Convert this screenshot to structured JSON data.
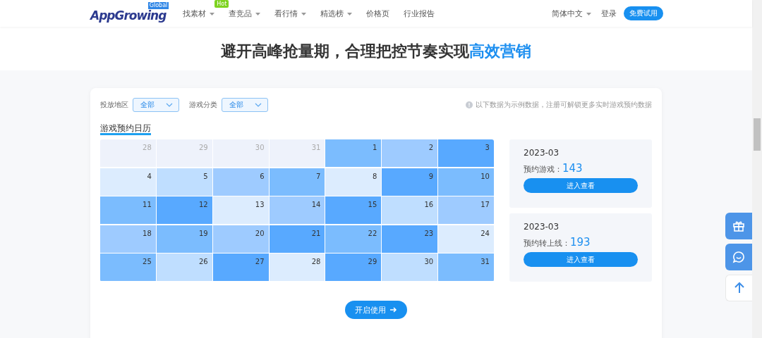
{
  "header": {
    "logo": "AppGrowing",
    "logo_badge": "Global",
    "nav": [
      {
        "label": "找素材",
        "dropdown": true,
        "badge": "Hot"
      },
      {
        "label": "查竞品",
        "dropdown": true
      },
      {
        "label": "看行情",
        "dropdown": true
      },
      {
        "label": "精选榜",
        "dropdown": true
      },
      {
        "label": "价格页",
        "dropdown": false
      },
      {
        "label": "行业报告",
        "dropdown": false
      }
    ],
    "language": "简体中文",
    "login": "登录",
    "trial_button": "免费试用"
  },
  "headline": [
    {
      "text": "避开高峰抢量期，合理把控节奏实现",
      "accent": false
    },
    {
      "text": "高效营销",
      "accent": true
    }
  ],
  "filters": [
    {
      "label": "投放地区",
      "value": "全部"
    },
    {
      "label": "游戏分类",
      "value": "全部"
    }
  ],
  "notice": "以下数据为示例数据，注册可解锁更多实时游戏预约数据",
  "calendar": {
    "title": "游戏预约日历",
    "days": [
      {
        "day": "28",
        "kind": "outside",
        "color": "#eef2fb"
      },
      {
        "day": "29",
        "kind": "outside",
        "color": "#eef2fb"
      },
      {
        "day": "30",
        "kind": "outside",
        "color": "#eef2fb"
      },
      {
        "day": "31",
        "kind": "outside",
        "color": "#eef2fb"
      },
      {
        "day": "1",
        "kind": "day",
        "color": "#7bbcfe"
      },
      {
        "day": "2",
        "kind": "day",
        "color": "#9ecbff"
      },
      {
        "day": "3",
        "kind": "day",
        "color": "#58a9ff"
      },
      {
        "day": "4",
        "kind": "day",
        "color": "#dcecfe"
      },
      {
        "day": "5",
        "kind": "day",
        "color": "#bfdeff"
      },
      {
        "day": "6",
        "kind": "day",
        "color": "#9ecbff"
      },
      {
        "day": "7",
        "kind": "day",
        "color": "#7bbcfe"
      },
      {
        "day": "8",
        "kind": "day",
        "color": "#dcecfe"
      },
      {
        "day": "9",
        "kind": "day",
        "color": "#58a9ff"
      },
      {
        "day": "10",
        "kind": "day",
        "color": "#7bbcfe"
      },
      {
        "day": "11",
        "kind": "day",
        "color": "#7bbcfe"
      },
      {
        "day": "12",
        "kind": "day",
        "color": "#58a9ff"
      },
      {
        "day": "13",
        "kind": "day",
        "color": "#dcecfe"
      },
      {
        "day": "14",
        "kind": "day",
        "color": "#9ecbff"
      },
      {
        "day": "15",
        "kind": "day",
        "color": "#58a9ff"
      },
      {
        "day": "16",
        "kind": "day",
        "color": "#bfdeff"
      },
      {
        "day": "17",
        "kind": "day",
        "color": "#9ecbff"
      },
      {
        "day": "18",
        "kind": "day",
        "color": "#9ecbff"
      },
      {
        "day": "19",
        "kind": "day",
        "color": "#7bbcfe"
      },
      {
        "day": "20",
        "kind": "day",
        "color": "#9ecbff"
      },
      {
        "day": "21",
        "kind": "day",
        "color": "#58a9ff"
      },
      {
        "day": "22",
        "kind": "day",
        "color": "#7bbcfe"
      },
      {
        "day": "23",
        "kind": "day",
        "color": "#58a9ff"
      },
      {
        "day": "24",
        "kind": "day",
        "color": "#dcecfe"
      },
      {
        "day": "25",
        "kind": "day",
        "color": "#7bbcfe"
      },
      {
        "day": "26",
        "kind": "day",
        "color": "#bfdeff"
      },
      {
        "day": "27",
        "kind": "day",
        "color": "#58a9ff"
      },
      {
        "day": "28",
        "kind": "day",
        "color": "#dcecfe"
      },
      {
        "day": "29",
        "kind": "day",
        "color": "#58a9ff"
      },
      {
        "day": "30",
        "kind": "day",
        "color": "#bfdeff"
      },
      {
        "day": "31",
        "kind": "day",
        "color": "#7bbcfe"
      }
    ]
  },
  "stats": [
    {
      "month": "2023-03",
      "label": "预约游戏：",
      "count": "143",
      "button": "进入查看"
    },
    {
      "month": "2023-03",
      "label": "预约转上线：",
      "count": "193",
      "button": "进入查看"
    }
  ],
  "start_button": "开启使用"
}
